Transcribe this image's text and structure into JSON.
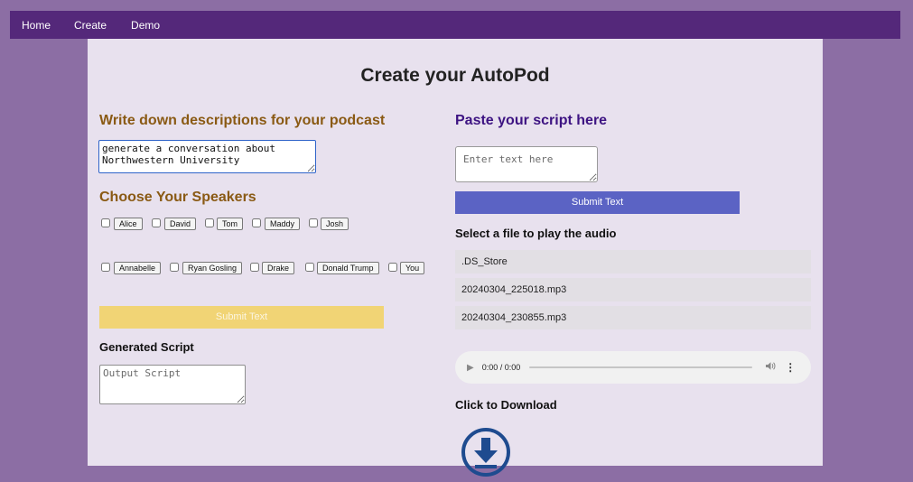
{
  "nav": {
    "items": [
      "Home",
      "Create",
      "Demo"
    ]
  },
  "page": {
    "title": "Create your AutoPod"
  },
  "left": {
    "description_heading": "Write down descriptions for your podcast",
    "description_value": "generate a conversation about\nNorthwestern University",
    "speakers_heading": "Choose Your Speakers",
    "speakers": [
      "Alice",
      "David",
      "Tom",
      "Maddy",
      "Josh",
      "Annabelle",
      "Ryan Gosling",
      "Drake",
      "Donald Trump",
      "You"
    ],
    "submit_label": "Submit Text",
    "generated_heading": "Generated Script",
    "output_placeholder": "Output Script"
  },
  "right": {
    "script_heading": "Paste your script here",
    "script_placeholder": "Enter text here",
    "submit_label": "Submit Text",
    "files_heading": "Select a file to play the audio",
    "files": [
      ".DS_Store",
      "20240304_225018.mp3",
      "20240304_230855.mp3"
    ],
    "audio_time": "0:00 / 0:00",
    "download_heading": "Click to Download"
  },
  "colors": {
    "background": "#8c6ea4",
    "navbar": "#54287a",
    "panel": "#e8e1ee",
    "gold_heading": "#8a5a14",
    "purple_heading": "#3d1382",
    "gold_button": "#f1d475",
    "blue_button": "#5b63c4",
    "download_icon": "#1e4b8f"
  },
  "icons": {
    "play": "play-icon",
    "volume": "volume-icon",
    "more": "more-vertical-icon",
    "download": "download-circle-icon"
  }
}
